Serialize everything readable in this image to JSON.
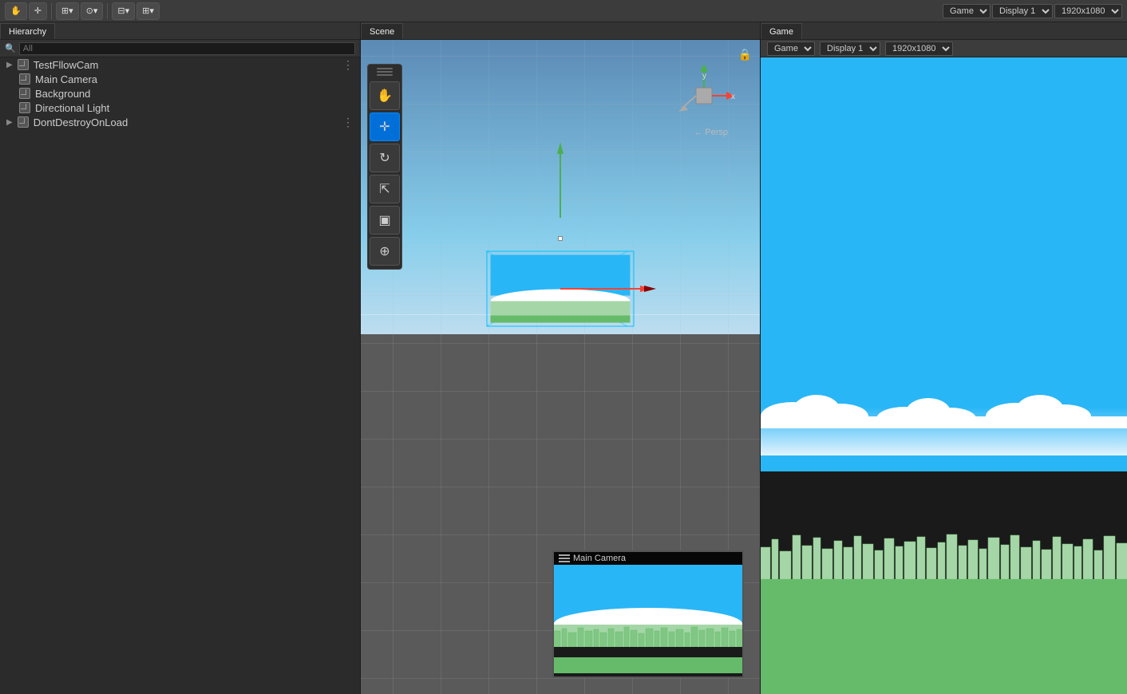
{
  "topbar": {
    "groups": [
      {
        "id": "hand",
        "label": "✋",
        "icon": "hand-icon"
      },
      {
        "id": "move",
        "label": "⊕",
        "icon": "move-icon"
      },
      {
        "id": "pivot",
        "label": "⊞",
        "icon": "pivot-icon"
      },
      {
        "id": "global",
        "label": "⊙",
        "icon": "global-icon"
      },
      {
        "id": "snap",
        "label": "⊟",
        "icon": "snap-icon"
      }
    ],
    "right_dropdowns": [
      {
        "label": "Game",
        "value": "Game"
      },
      {
        "label": "Display 1",
        "value": "Display 1"
      },
      {
        "label": "1920x1080",
        "value": "1920x1080"
      }
    ]
  },
  "hierarchy": {
    "title": "Hierarchy",
    "search_placeholder": "All",
    "items": [
      {
        "id": "testflowcam",
        "label": "TestFllowCam",
        "indent": 0,
        "has_more": true
      },
      {
        "id": "main-camera",
        "label": "Main Camera",
        "indent": 1,
        "has_more": false
      },
      {
        "id": "background",
        "label": "Background",
        "indent": 1,
        "has_more": false
      },
      {
        "id": "directional-light",
        "label": "Directional Light",
        "indent": 1,
        "has_more": false
      },
      {
        "id": "dont-destroy",
        "label": "DontDestroyOnLoad",
        "indent": 0,
        "has_more": true
      }
    ]
  },
  "scene": {
    "title": "Scene",
    "tab_label": "Scene",
    "persp_label": "← Persp",
    "gizmo_x": "x",
    "gizmo_y": "y",
    "tools": [
      {
        "id": "hand",
        "icon": "✋",
        "label": "hand-tool",
        "active": false
      },
      {
        "id": "move",
        "icon": "✛",
        "label": "move-tool",
        "active": true
      },
      {
        "id": "rotate",
        "icon": "↻",
        "label": "rotate-tool",
        "active": false
      },
      {
        "id": "scale",
        "icon": "⇱",
        "label": "scale-tool",
        "active": false
      },
      {
        "id": "rect",
        "icon": "▣",
        "label": "rect-tool",
        "active": false
      },
      {
        "id": "transform",
        "icon": "⊕",
        "label": "transform-tool",
        "active": false
      }
    ]
  },
  "camera_preview": {
    "title": "Main Camera",
    "menu_icon": "≡"
  },
  "game_view": {
    "title": "Game",
    "tab_label": "Game",
    "dropdown_game": "Game",
    "dropdown_display": "Display 1",
    "dropdown_res": "1920x1080"
  }
}
